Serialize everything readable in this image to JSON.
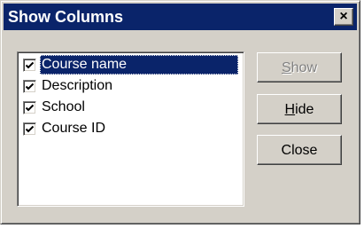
{
  "dialog": {
    "title": "Show Columns",
    "close_glyph": "×"
  },
  "columns": [
    {
      "label": "Course name",
      "checked": true,
      "selected": true
    },
    {
      "label": "Description",
      "checked": true,
      "selected": false
    },
    {
      "label": "School",
      "checked": true,
      "selected": false
    },
    {
      "label": "Course ID",
      "checked": true,
      "selected": false
    }
  ],
  "buttons": {
    "show": {
      "accel": "S",
      "rest": "how",
      "enabled": false
    },
    "hide": {
      "accel": "H",
      "rest": "ide",
      "enabled": true
    },
    "close": {
      "label": "Close",
      "enabled": true
    }
  },
  "colors": {
    "titlebar": "#0a246a",
    "face": "#d4d0c8",
    "selection": "#0a246a"
  }
}
